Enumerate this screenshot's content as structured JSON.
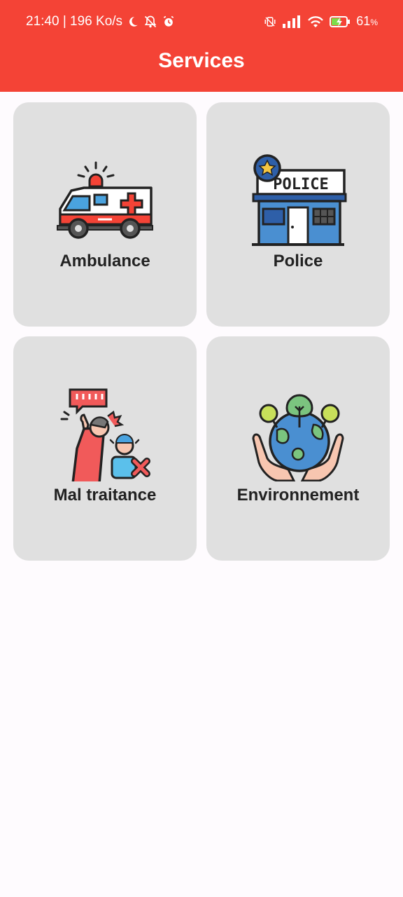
{
  "status_bar": {
    "time_speed": "21:40 | 196 Ko/s",
    "battery": "61",
    "battery_unit": "%",
    "icons": [
      "moon-icon",
      "bell-off-icon",
      "alarm-icon",
      "vibrate-icon",
      "signal-icon",
      "wifi-icon",
      "battery-charging-icon"
    ]
  },
  "header": {
    "title": "Services",
    "color": "#f44336"
  },
  "services": [
    {
      "label": "Ambulance",
      "icon": "ambulance-icon"
    },
    {
      "label": "Police",
      "icon": "police-station-icon"
    },
    {
      "label": "Mal traitance",
      "icon": "abuse-icon"
    },
    {
      "label": "Environnement",
      "icon": "earth-in-hands-icon"
    }
  ]
}
